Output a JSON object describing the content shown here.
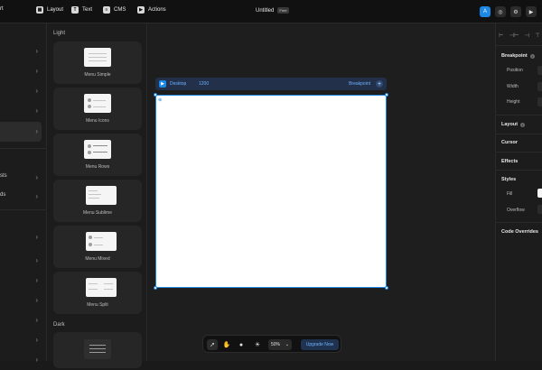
{
  "topbar": {
    "left_partial": "rt",
    "items": [
      {
        "icon": "layout-icon",
        "glyph": "▦",
        "label": "Layout"
      },
      {
        "icon": "text-icon",
        "glyph": "T",
        "label": "Text"
      },
      {
        "icon": "cms-icon",
        "glyph": "≡",
        "label": "CMS"
      },
      {
        "icon": "actions-icon",
        "glyph": "▶",
        "label": "Actions"
      }
    ],
    "title": "Untitled",
    "badge": "Free",
    "user_initial": "A"
  },
  "left_panel": {
    "rows": [
      "",
      "",
      "",
      "",
      "",
      "sts",
      "ds",
      "",
      "",
      "",
      "",
      "",
      "",
      ""
    ]
  },
  "library": {
    "section_light": "Light",
    "section_dark": "Dark",
    "cards": [
      "Menu Simple",
      "Menu Icons",
      "Menu Rows",
      "Menu Sublime",
      "Menu Mixed",
      "Menu Split"
    ]
  },
  "canvas": {
    "frame_name": "Desktop",
    "frame_size": "1200",
    "breakpoint_label": "Breakpoint",
    "zoom": "50%",
    "upgrade_label": "Upgrade Now"
  },
  "right_panel": {
    "breakpoint": "Breakpoint",
    "position": "Position",
    "width": "Width",
    "height": "Height",
    "layout": "Layout",
    "cursor": "Cursor",
    "effects": "Effects",
    "styles": "Styles",
    "fill": "Fill",
    "overflow": "Overflow",
    "code_overrides": "Code Overrides"
  },
  "colors": {
    "accent": "#1e88e5",
    "panel": "#1c1c1c",
    "canvas": "#1e1e1e"
  }
}
